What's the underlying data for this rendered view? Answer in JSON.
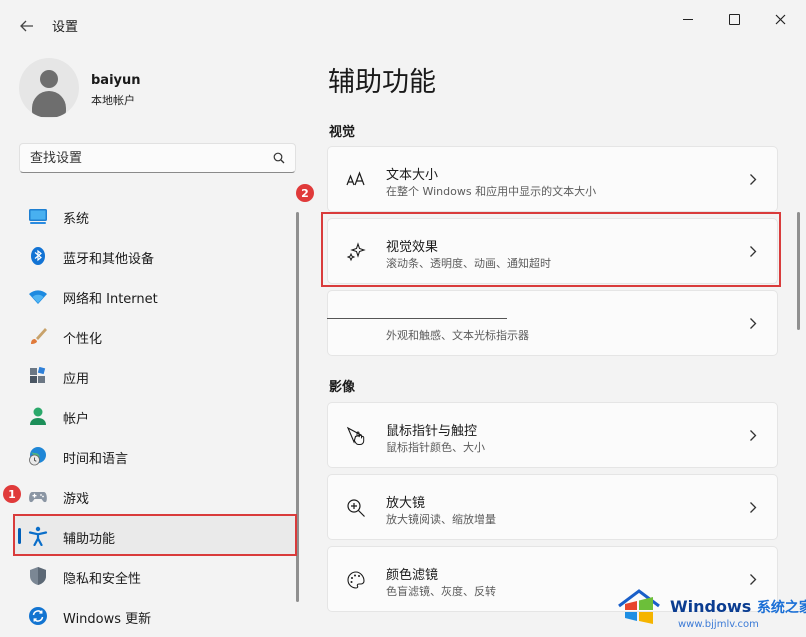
{
  "titlebar": {
    "title": "设置",
    "back_icon": "back-arrow-icon",
    "window_controls": [
      "minimize",
      "maximize",
      "close"
    ]
  },
  "profile": {
    "name": "baiyun",
    "account_type": "本地帐户"
  },
  "search": {
    "placeholder": "查找设置"
  },
  "sidebar": {
    "items": [
      {
        "label": "系统",
        "icon": "system-icon"
      },
      {
        "label": "蓝牙和其他设备",
        "icon": "bluetooth-icon"
      },
      {
        "label": "网络和 Internet",
        "icon": "wifi-icon"
      },
      {
        "label": "个性化",
        "icon": "brush-icon"
      },
      {
        "label": "应用",
        "icon": "apps-icon"
      },
      {
        "label": "帐户",
        "icon": "account-icon"
      },
      {
        "label": "时间和语言",
        "icon": "globe-clock-icon"
      },
      {
        "label": "游戏",
        "icon": "gamepad-icon"
      },
      {
        "label": "辅助功能",
        "icon": "accessibility-icon",
        "active": true
      },
      {
        "label": "隐私和安全性",
        "icon": "shield-icon"
      },
      {
        "label": "Windows 更新",
        "icon": "update-icon"
      }
    ]
  },
  "main": {
    "title": "辅助功能",
    "sections": [
      {
        "title": "视觉",
        "cards": [
          {
            "title": "文本大小",
            "desc": "在整个 Windows 和应用中显示的文本大小",
            "icon": "text-size-icon"
          },
          {
            "title": "视觉效果",
            "desc": "滚动条、透明度、动画、通知超时",
            "icon": "sparkle-icon"
          },
          {
            "title": "",
            "desc": "外观和触感、文本光标指示器",
            "icon": ""
          }
        ]
      },
      {
        "title": "影像",
        "cards": [
          {
            "title": "鼠标指针与触控",
            "desc": "鼠标指针颜色、大小",
            "icon": "pointer-touch-icon"
          },
          {
            "title": "放大镜",
            "desc": "放大镜阅读、缩放增量",
            "icon": "magnifier-icon"
          },
          {
            "title": "颜色滤镜",
            "desc": "色盲滤镜、灰度、反转",
            "icon": "palette-icon"
          }
        ]
      }
    ]
  },
  "annotations": {
    "badge_1": "1",
    "badge_2": "2",
    "highlight_color": "#d93b3b"
  },
  "watermark": {
    "brand": "Windows",
    "brand_cn": "系统之家",
    "url": "www.bjjmlv.com"
  },
  "colors": {
    "accent": "#005fb8",
    "background": "#f3f3f3",
    "card": "#fbfbfb"
  }
}
